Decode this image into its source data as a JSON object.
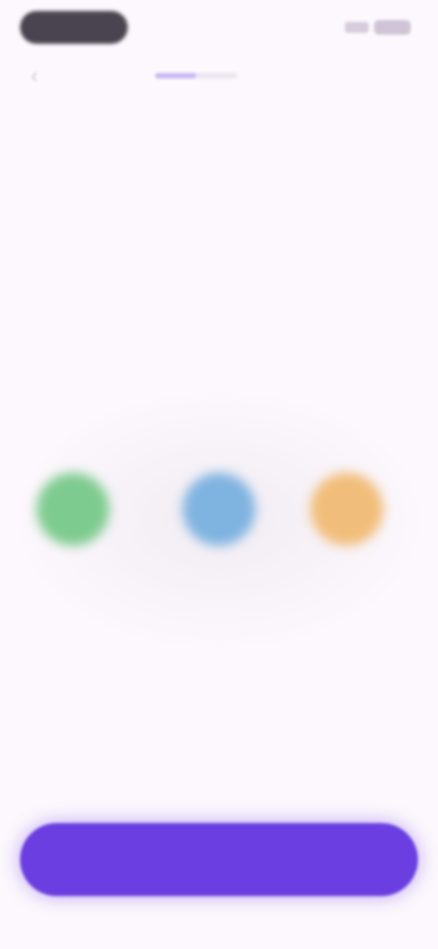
{
  "onboarding": {
    "progress": 0.5,
    "options": [
      {
        "label": "",
        "color": "#7ecb8f"
      },
      {
        "label": "",
        "color": "#7fb3e0"
      },
      {
        "label": "",
        "color": "#f1bd7a"
      }
    ],
    "cta_label": ""
  },
  "colors": {
    "background": "#fdf8fd",
    "accent": "#6a3ee0",
    "progress": "#c9b8f4"
  }
}
